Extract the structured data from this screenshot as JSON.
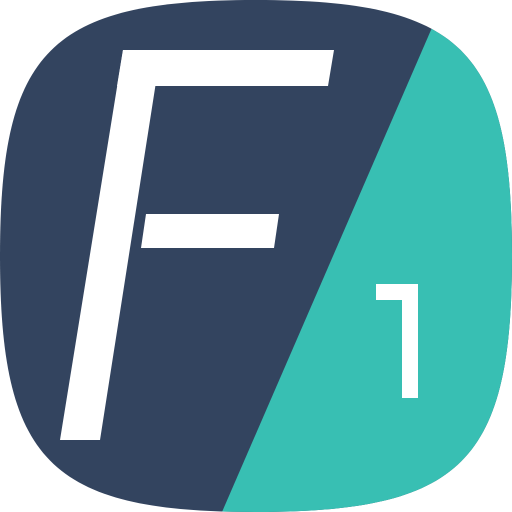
{
  "app_icon": {
    "letter": "F",
    "number": "1",
    "colors": {
      "dark_panel": "#33445F",
      "accent_panel": "#38BFB3",
      "glyph": "#FFFFFF",
      "background": "#FFFFFF"
    }
  }
}
